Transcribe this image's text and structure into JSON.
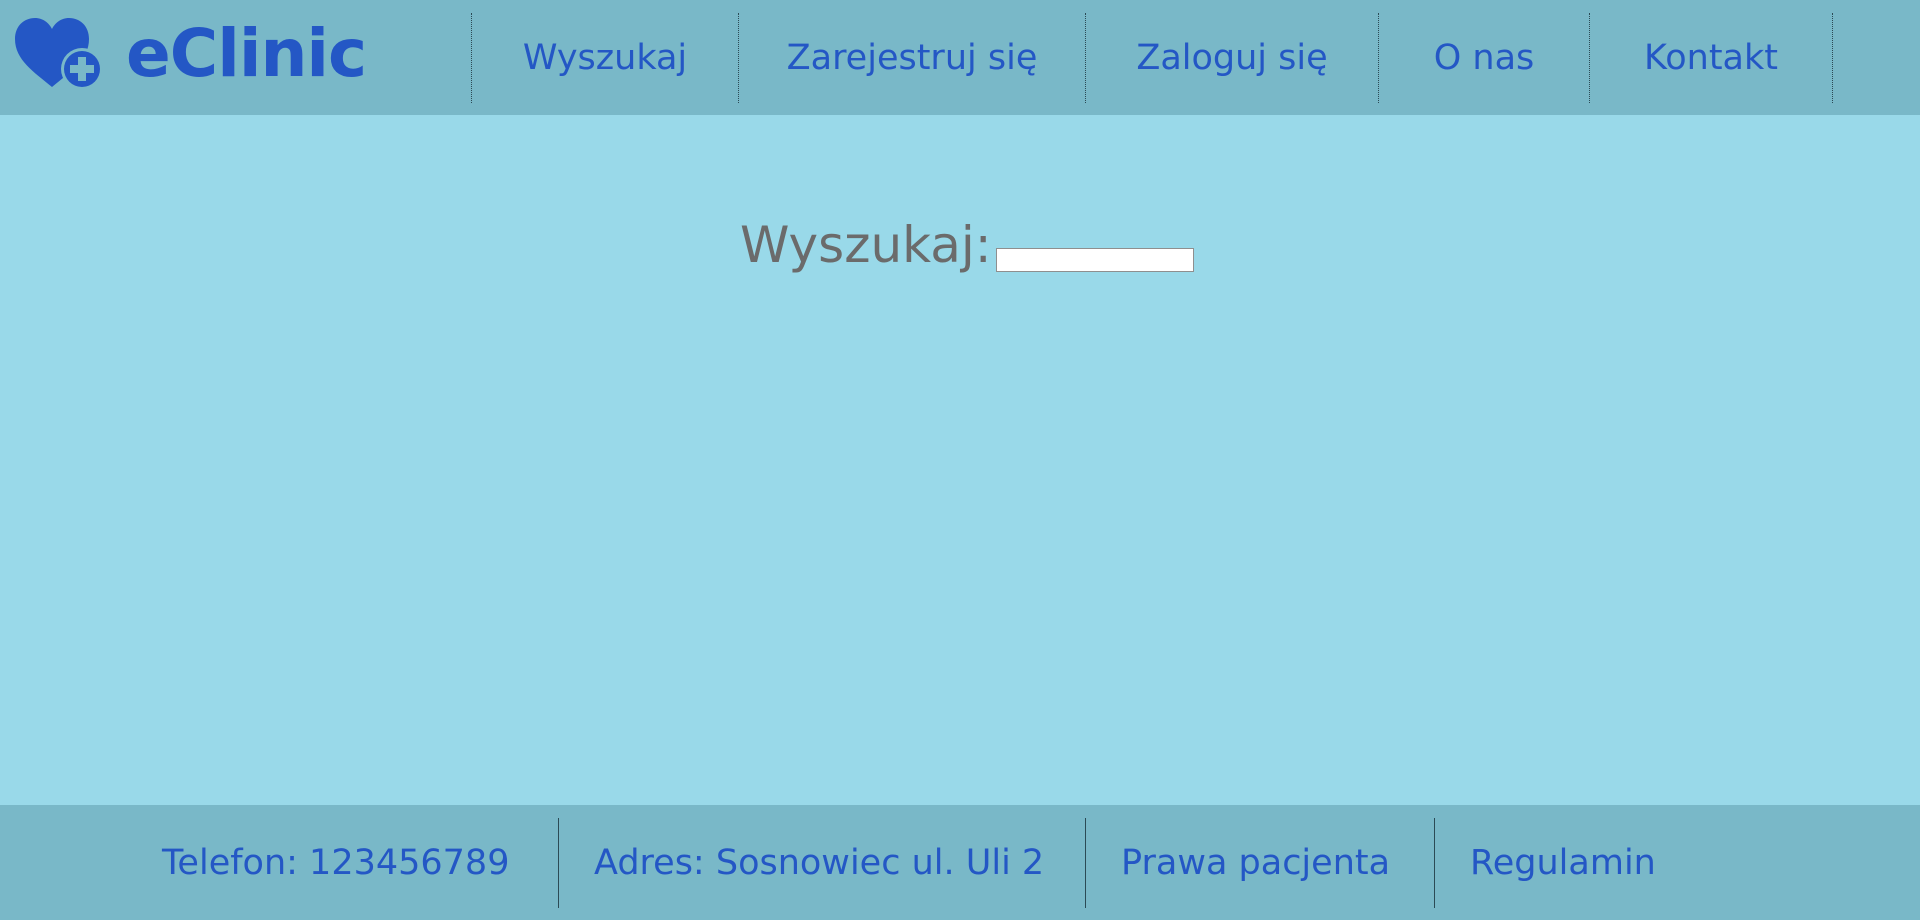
{
  "brand": {
    "name": "eClinic",
    "logo_icon": "heart-plus-icon",
    "color": "#2457c5"
  },
  "nav": {
    "items": [
      {
        "label": "Wyszukaj"
      },
      {
        "label": "Zarejestruj się"
      },
      {
        "label": "Zaloguj się"
      },
      {
        "label": "O nas"
      },
      {
        "label": "Kontakt"
      }
    ]
  },
  "search": {
    "label": "Wyszukaj:",
    "value": "",
    "placeholder": ""
  },
  "footer": {
    "phone": "Telefon: 123456789",
    "address": "Adres: Sosnowiec ul. Uli 2",
    "patient_rights": "Prawa pacjenta",
    "terms": "Regulamin"
  },
  "colors": {
    "header_bg": "#79b8c8",
    "page_bg": "#99d9e9",
    "link": "#2457c5",
    "label_gray": "#6b6b6b"
  }
}
